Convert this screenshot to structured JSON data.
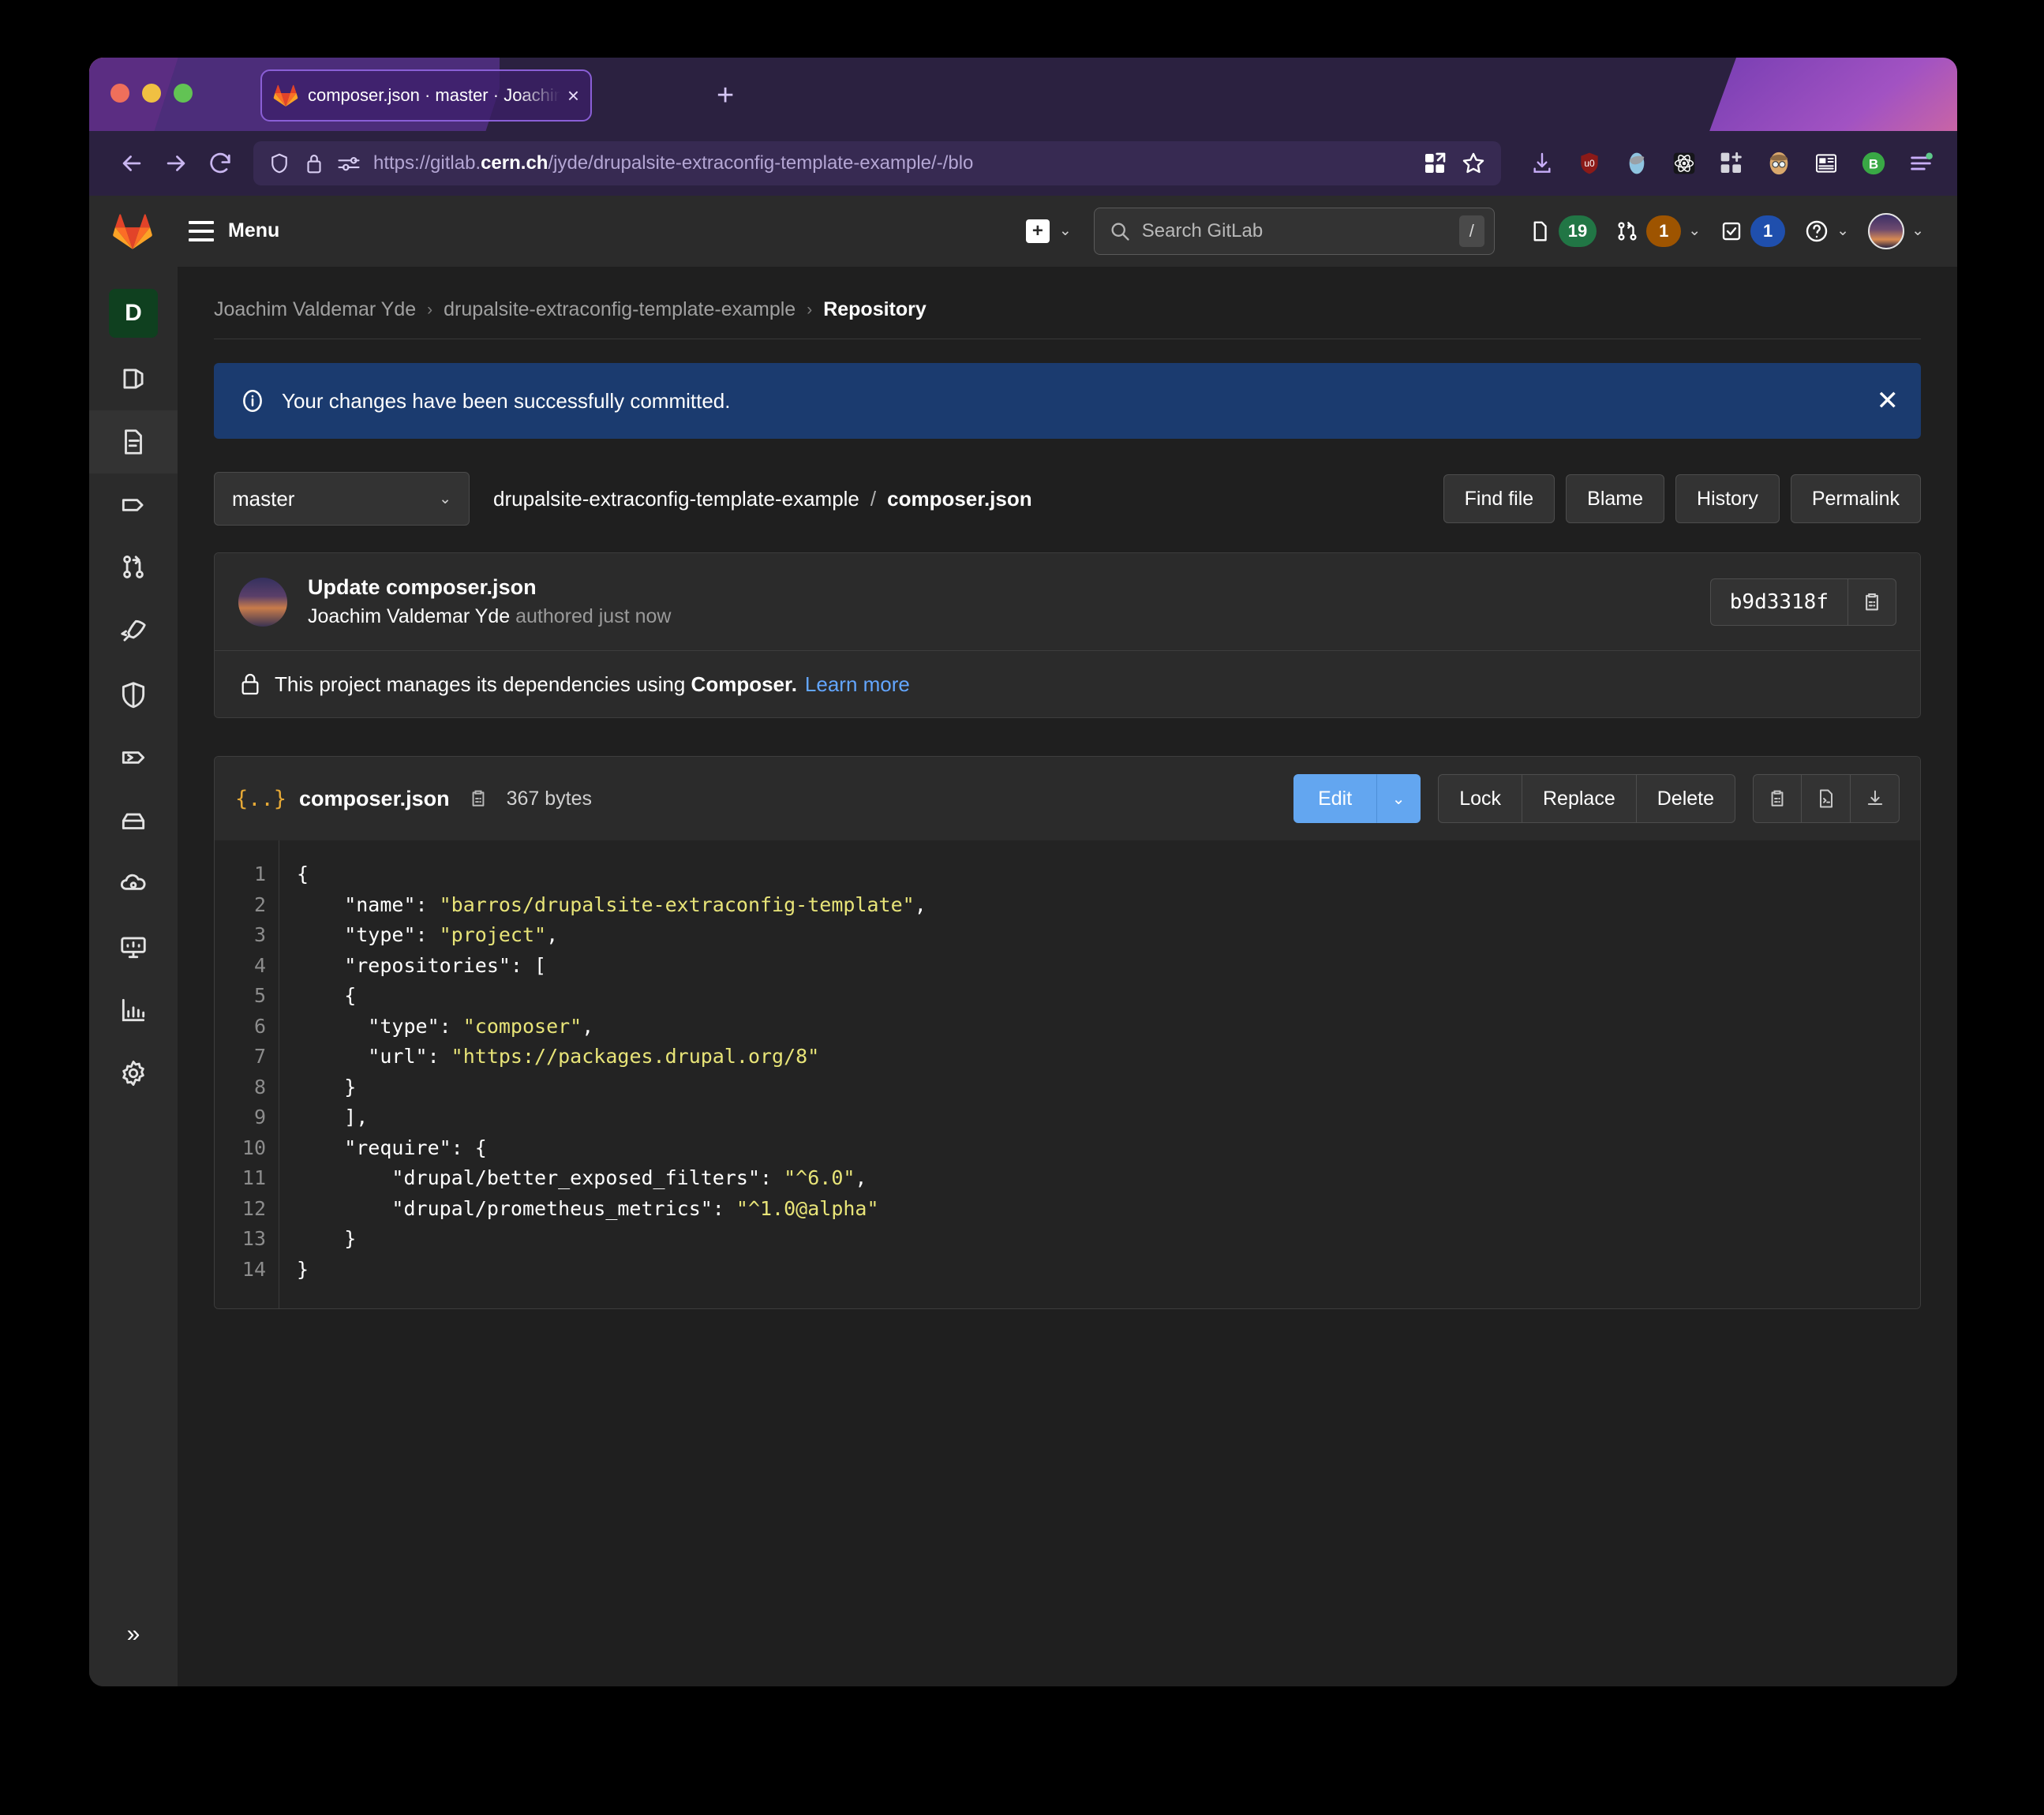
{
  "browser": {
    "tab": {
      "title": "composer.json · master · Joachim Valdemar Yde / ...",
      "favicon": "gitlab-icon",
      "close": "×"
    },
    "new_tab_label": "+",
    "nav": {
      "back": "←",
      "forward": "→",
      "reload": "⟳"
    },
    "url": {
      "prefix": "https://gitlab.",
      "domain": "cern.ch",
      "suffix": "/jyde/drupalsite-extraconfig-template-example/-/blo"
    },
    "url_icons": [
      "shield-icon",
      "lock-icon",
      "permissions-icon"
    ],
    "urlbar_right_icons": [
      "reader-view-icon",
      "bookmark-star-icon"
    ],
    "extension_icons": [
      "download-icon",
      "ublock-origin-icon",
      "zotero-icon",
      "react-devtools-icon",
      "add-extension-icon",
      "persona-icon",
      "news-reader-icon",
      "bitwarden-icon",
      "firefox-menu-icon"
    ]
  },
  "gitlab_header": {
    "logo": "gitlab-logo",
    "menu_label": "Menu",
    "create_new": {
      "icon": "plus-square-icon",
      "caret": "⌄"
    },
    "search": {
      "icon": "search-icon",
      "placeholder": "Search GitLab",
      "shortcut": "/"
    },
    "nav_items": [
      {
        "name": "issues",
        "icon": "issues-icon",
        "count": "19",
        "color": "#217645"
      },
      {
        "name": "merge-requests",
        "icon": "merge-request-icon",
        "count": "1",
        "color": "#9e5400",
        "caret": "⌄"
      },
      {
        "name": "todos",
        "icon": "todo-icon",
        "count": "1",
        "color": "#1f4fad"
      },
      {
        "name": "help",
        "icon": "help-icon",
        "caret": "⌄"
      },
      {
        "name": "user",
        "icon": "avatar",
        "caret": "⌄"
      }
    ]
  },
  "sidebar": {
    "project_initial": "D",
    "items": [
      {
        "name": "project-overview",
        "icon": "project-icon"
      },
      {
        "name": "repository",
        "icon": "document-icon",
        "active": true
      },
      {
        "name": "issues",
        "icon": "issue-tag-icon"
      },
      {
        "name": "merge-requests",
        "icon": "merge-icon"
      },
      {
        "name": "ci-cd",
        "icon": "rocket-icon"
      },
      {
        "name": "security-compliance",
        "icon": "shield-icon"
      },
      {
        "name": "deployments",
        "icon": "deployment-icon"
      },
      {
        "name": "packages-registries",
        "icon": "package-icon"
      },
      {
        "name": "infrastructure",
        "icon": "cloud-icon"
      },
      {
        "name": "monitor",
        "icon": "monitor-icon"
      },
      {
        "name": "analytics",
        "icon": "chart-icon"
      },
      {
        "name": "settings",
        "icon": "gear-icon"
      }
    ],
    "collapse": "»"
  },
  "breadcrumb": {
    "items": [
      "Joachim Valdemar Yde",
      "drupalsite-extraconfig-template-example"
    ],
    "current": "Repository",
    "separator": "›"
  },
  "alert": {
    "icon": "info-icon",
    "message": "Your changes have been successfully committed.",
    "close": "✕",
    "color": "#1b3b6f"
  },
  "filebar": {
    "branch": "master",
    "branch_caret": "⌄",
    "repo_name": "drupalsite-extraconfig-template-example",
    "path_separator": "/",
    "file_name": "composer.json",
    "actions": [
      "Find file",
      "Blame",
      "History",
      "Permalink"
    ]
  },
  "commit": {
    "title": "Update composer.json",
    "author": "Joachim Valdemar Yde",
    "authored_text": "authored just now",
    "sha": "b9d3318f",
    "copy_icon": "copy-icon"
  },
  "composer_notice": {
    "icon": "package-lock-icon",
    "text_before": "This project manages its dependencies using",
    "bold": "Composer.",
    "link": "Learn more"
  },
  "file_panel": {
    "type_icon": "{..}",
    "name": "composer.json",
    "copy_icon": "copy-path-icon",
    "size": "367 bytes",
    "edit_label": "Edit",
    "edit_caret": "⌄",
    "segmented_actions": [
      "Lock",
      "Replace",
      "Delete"
    ],
    "icon_actions": [
      "copy-contents-icon",
      "open-raw-icon",
      "download-icon"
    ],
    "edit_color": "#63a6f0"
  },
  "code": {
    "line_numbers": [
      "1",
      "2",
      "3",
      "4",
      "5",
      "6",
      "7",
      "8",
      "9",
      "10",
      "11",
      "12",
      "13",
      "14"
    ],
    "lines": [
      [
        {
          "t": "{",
          "c": "key"
        }
      ],
      [
        {
          "t": "    \"name\": ",
          "c": "key"
        },
        {
          "t": "\"barros/drupalsite-extraconfig-template\"",
          "c": "str"
        },
        {
          "t": ",",
          "c": "key"
        }
      ],
      [
        {
          "t": "    \"type\": ",
          "c": "key"
        },
        {
          "t": "\"project\"",
          "c": "str"
        },
        {
          "t": ",",
          "c": "key"
        }
      ],
      [
        {
          "t": "    \"repositories\": [",
          "c": "key"
        }
      ],
      [
        {
          "t": "    {",
          "c": "key"
        }
      ],
      [
        {
          "t": "      \"type\": ",
          "c": "key"
        },
        {
          "t": "\"composer\"",
          "c": "str"
        },
        {
          "t": ",",
          "c": "key"
        }
      ],
      [
        {
          "t": "      \"url\": ",
          "c": "key"
        },
        {
          "t": "\"https://packages.drupal.org/8\"",
          "c": "str"
        }
      ],
      [
        {
          "t": "    }",
          "c": "key"
        }
      ],
      [
        {
          "t": "    ],",
          "c": "key"
        }
      ],
      [
        {
          "t": "    \"require\": {",
          "c": "key"
        }
      ],
      [
        {
          "t": "        \"drupal/better_exposed_filters\": ",
          "c": "key"
        },
        {
          "t": "\"^6.0\"",
          "c": "str"
        },
        {
          "t": ",",
          "c": "key"
        }
      ],
      [
        {
          "t": "        \"drupal/prometheus_metrics\": ",
          "c": "key"
        },
        {
          "t": "\"^1.0@alpha\"",
          "c": "str"
        }
      ],
      [
        {
          "t": "    }",
          "c": "key"
        }
      ],
      [
        {
          "t": "}",
          "c": "key"
        }
      ]
    ]
  }
}
